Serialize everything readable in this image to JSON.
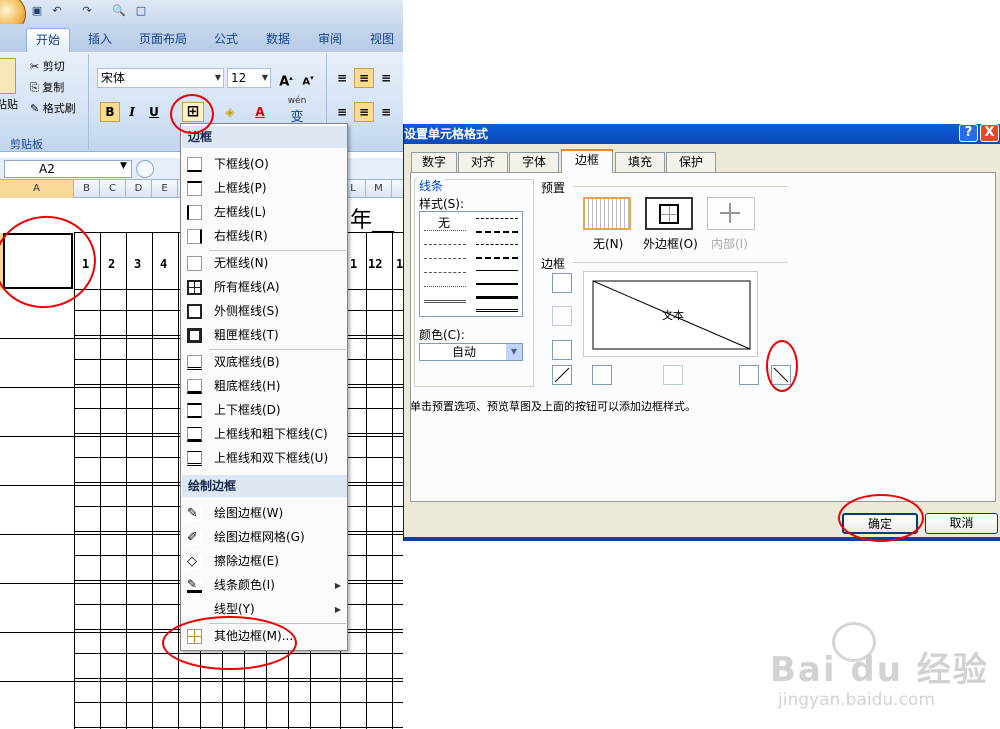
{
  "excel": {
    "quick_access": {
      "icons": [
        "save-icon",
        "undo-icon",
        "redo-icon",
        "print-preview-icon",
        "new-icon"
      ]
    },
    "tabs": [
      {
        "label": "开始",
        "active": true
      },
      {
        "label": "插入"
      },
      {
        "label": "页面布局"
      },
      {
        "label": "公式"
      },
      {
        "label": "数据"
      },
      {
        "label": "审阅"
      },
      {
        "label": "视图"
      }
    ],
    "clipboard": {
      "paste_label": "粘贴",
      "cut": "剪切",
      "copy": "复制",
      "format_painter": "格式刷",
      "group_label": "剪贴板"
    },
    "font": {
      "name": "宋体",
      "size": "12",
      "bold": "B",
      "italic": "I",
      "underline": "U",
      "wen": "wén",
      "wen_char": "变"
    },
    "name_box": "A2",
    "columns": [
      "A",
      "B",
      "C",
      "D",
      "E",
      "L",
      "M"
    ],
    "sheet_numbers": [
      "1",
      "2",
      "3",
      "4",
      "1",
      "12",
      "1"
    ],
    "header_text": "年__"
  },
  "border_menu": {
    "section1": "边框",
    "items1": [
      "下框线(O)",
      "上框线(P)",
      "左框线(L)",
      "右框线(R)",
      "无框线(N)",
      "所有框线(A)",
      "外侧框线(S)",
      "粗匣框线(T)",
      "双底框线(B)",
      "粗底框线(H)",
      "上下框线(D)",
      "上框线和粗下框线(C)",
      "上框线和双下框线(U)"
    ],
    "section2": "绘制边框",
    "items2": [
      "绘图边框(W)",
      "绘图边框网格(G)",
      "擦除边框(E)",
      "线条颜色(I)",
      "线型(Y)"
    ],
    "more": "其他边框(M)..."
  },
  "dialog": {
    "title": "设置单元格格式",
    "help": "?",
    "close": "X",
    "tabs": [
      "数字",
      "对齐",
      "字体",
      "边框",
      "填充",
      "保护"
    ],
    "active_tab": "边框",
    "line_group": "线条",
    "style_label": "样式(S):",
    "none_style": "无",
    "color_label": "颜色(C):",
    "color_value": "自动",
    "preset_group": "预置",
    "presets": [
      "无(N)",
      "外边框(O)",
      "内部(I)"
    ],
    "border_group": "边框",
    "preview_text": "文本",
    "hint": "单击预置选项、预览草图及上面的按钮可以添加边框样式。",
    "ok": "确定",
    "cancel": "取消"
  },
  "watermark": {
    "logo": "Bai du 经验",
    "url": "jingyan.baidu.com"
  },
  "colors": {
    "accent": "#e00000",
    "ribbon": "#d5e3f5",
    "dialog_bg": "#ece9d8",
    "title_blue": "#0a5fd8"
  }
}
